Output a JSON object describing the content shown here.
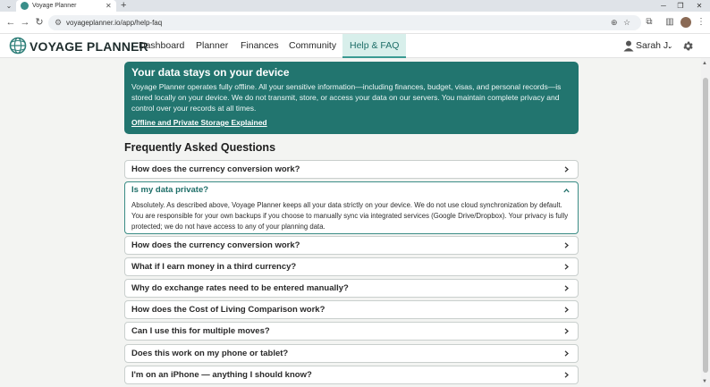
{
  "browser": {
    "tab_title": "Voyage Planner",
    "url": "voyageplanner.io/app/help-faq"
  },
  "app": {
    "brand": "VOYAGE PLANNER",
    "nav": [
      "Dashboard",
      "Planner",
      "Finances",
      "Community",
      "Help & FAQ"
    ],
    "active_nav": "Help & FAQ",
    "user_name": "Sarah J."
  },
  "privacy": {
    "title": "Your data stays on your device",
    "text": "Voyage Planner operates fully offline. All your sensitive information—including finances, budget, visas, and personal records—is stored locally on your device. We do not transmit, store, or access your data on our servers. You maintain complete privacy and control over your records at all times.",
    "link": "Offline and Private Storage Explained"
  },
  "faq": {
    "heading": "Frequently Asked Questions",
    "items": [
      {
        "question": "How does the currency conversion work?",
        "expanded": false
      },
      {
        "question": "Is my data private?",
        "expanded": true,
        "answer": "Absolutely. As described above, Voyage Planner keeps all your data strictly on your device. We do not use cloud synchronization by default. You are responsible for your own backups if you choose to manually sync via integrated services (Google Drive/Dropbox). Your privacy is fully protected; we do not have access to any of your planning data."
      },
      {
        "question": "How does the currency conversion work?",
        "expanded": false
      },
      {
        "question": "What if I earn money in a third currency?",
        "expanded": false
      },
      {
        "question": "Why do exchange rates need to be entered manually?",
        "expanded": false
      },
      {
        "question": "How does the Cost of Living Comparison work?",
        "expanded": false
      },
      {
        "question": "Can I use this for multiple moves?",
        "expanded": false
      },
      {
        "question": "Does this work on my phone or tablet?",
        "expanded": false
      },
      {
        "question": "I'm on an iPhone — anything I should know?",
        "expanded": false
      }
    ]
  },
  "colors": {
    "accent": "#22756f",
    "active_nav_bg": "#d8efeb",
    "page_bg": "#f3f4f2"
  },
  "icons": {
    "logo": "globe-icon",
    "user": "user-icon",
    "settings": "gear-icon",
    "collapsed": "chevron-right-icon",
    "expanded": "chevron-up-icon"
  }
}
